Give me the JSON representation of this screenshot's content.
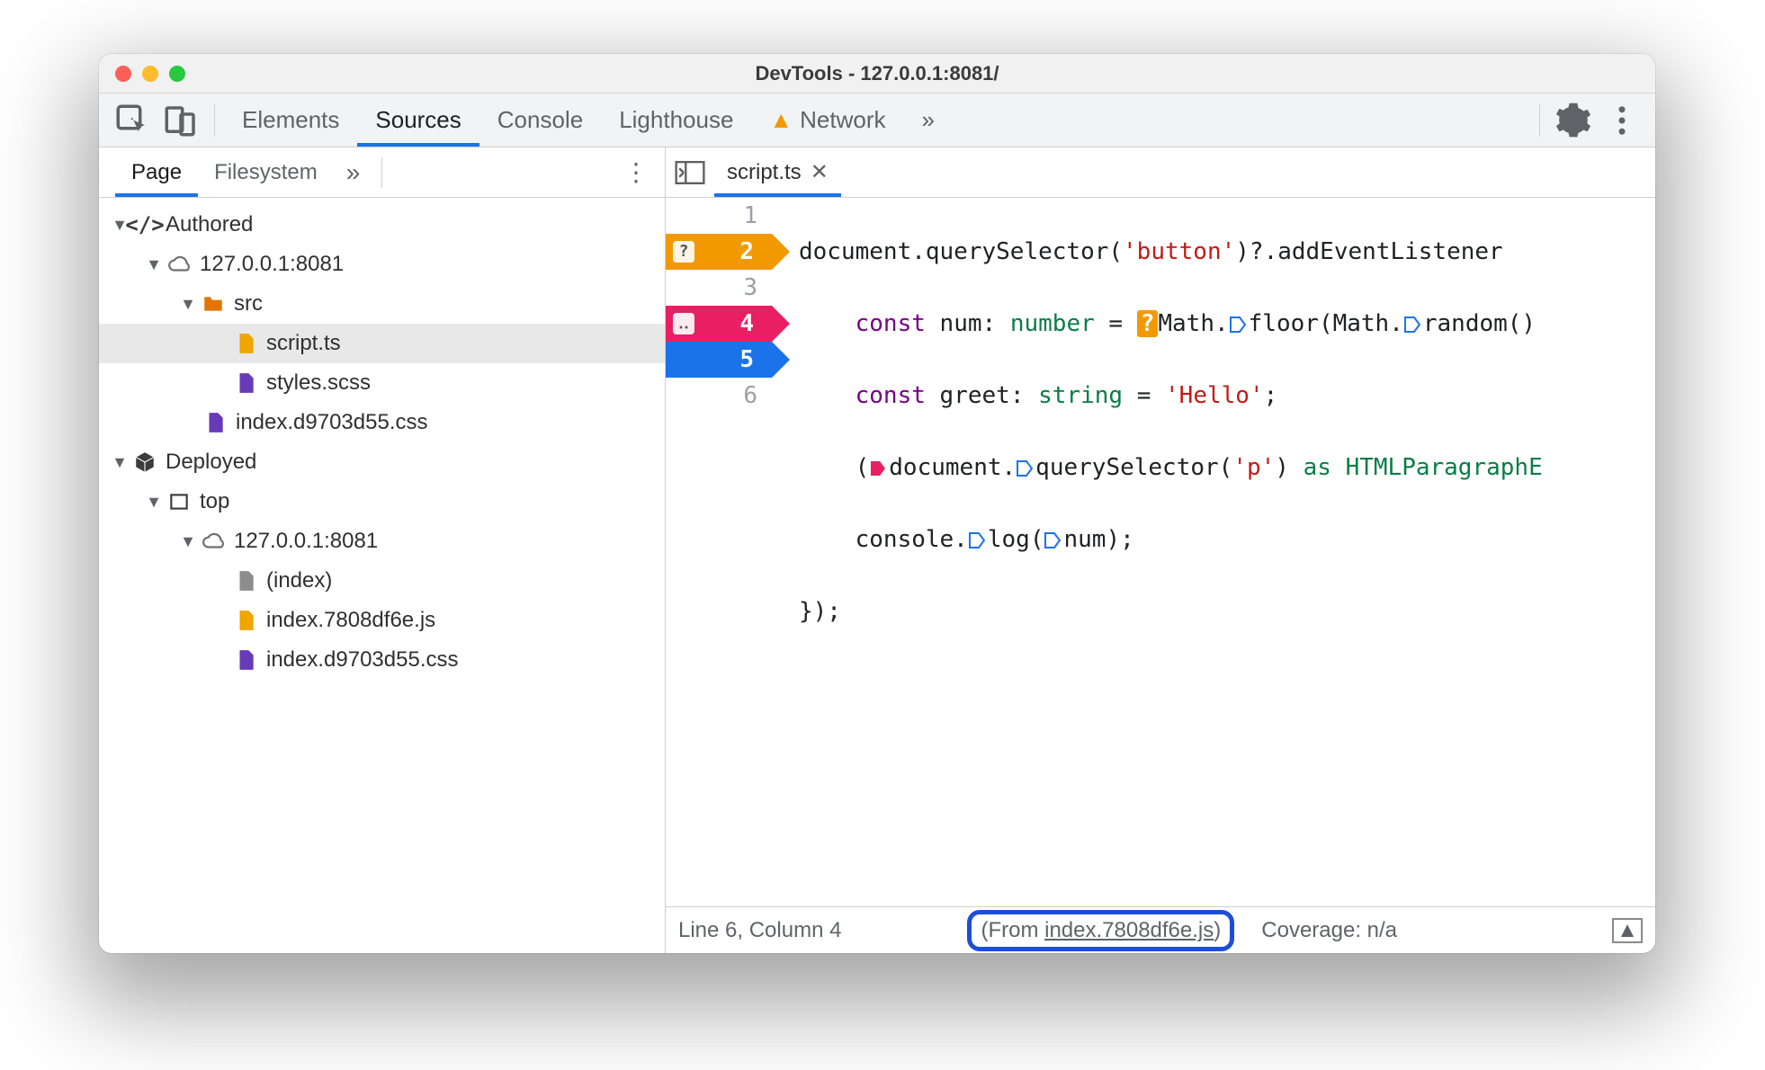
{
  "titlebar": {
    "title": "DevTools - 127.0.0.1:8081/"
  },
  "tabs": {
    "elements": "Elements",
    "sources": "Sources",
    "console": "Console",
    "lighthouse": "Lighthouse",
    "network": "Network",
    "overflow": "»"
  },
  "navigator": {
    "tabs": {
      "page": "Page",
      "filesystem": "Filesystem",
      "overflow": "»"
    },
    "tree": {
      "authored": "Authored",
      "host1": "127.0.0.1:8081",
      "src": "src",
      "script_ts": "script.ts",
      "styles_scss": "styles.scss",
      "authored_css": "index.d9703d55.css",
      "deployed": "Deployed",
      "top": "top",
      "host2": "127.0.0.1:8081",
      "index": "(index)",
      "index_js": "index.7808df6e.js",
      "deployed_css": "index.d9703d55.css"
    }
  },
  "editor": {
    "tab": "script.ts",
    "breakpoints": {
      "l2_badge": "?",
      "l2_num": "2",
      "l4_badge": "‥",
      "l4_num": "4",
      "l5_num": "5"
    },
    "gutter": {
      "l1": "1",
      "l2": "",
      "l3": "3",
      "l4": "",
      "l5": "",
      "l6": "6"
    },
    "code": {
      "l1": {
        "a": "document.querySelector(",
        "b": "'button'",
        "c": ")?.addEventListener"
      },
      "l2": {
        "kw": "const",
        "id": " num: ",
        "ty": "number",
        "eq": " = ",
        "pin": "?",
        "m": "Math.",
        "fn": "floor",
        "r": "(Math.",
        "rn": "random",
        "end": "()"
      },
      "l3": {
        "kw": "const",
        "id": " greet: ",
        "ty": "string",
        "eq": " = ",
        "str": "'Hello'",
        "end": ";"
      },
      "l4": {
        "a": "    (",
        "d": "document.",
        "q": "querySelector",
        "p": "(",
        "str": "'p'",
        "r": ") ",
        "as": "as",
        "he": " HTMLParagraphE"
      },
      "l5": {
        "a": "    console.",
        "log": "log",
        "p": "(",
        "num": "num",
        "end": ");"
      },
      "l6": "});"
    }
  },
  "status": {
    "cursor": "Line 6, Column 4",
    "from_prefix": "(From ",
    "from_link": "index.7808df6e.js",
    "from_suffix": ")",
    "coverage": "Coverage: n/a"
  }
}
